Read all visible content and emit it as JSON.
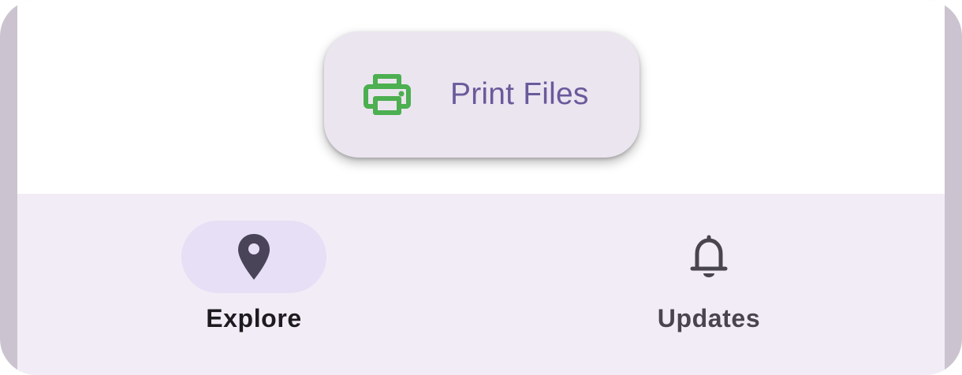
{
  "fab": {
    "label": "Print Files",
    "icon": "printer-icon",
    "icon_color": "#4caf50",
    "label_color": "#6a5a9b"
  },
  "nav": {
    "items": [
      {
        "label": "Explore",
        "icon": "location-pin-icon",
        "selected": true
      },
      {
        "label": "Updates",
        "icon": "bell-icon",
        "selected": false
      }
    ]
  },
  "colors": {
    "nav_background": "#f2ecf6",
    "active_indicator": "#e7dff5",
    "fab_background": "#ebe5f0"
  }
}
